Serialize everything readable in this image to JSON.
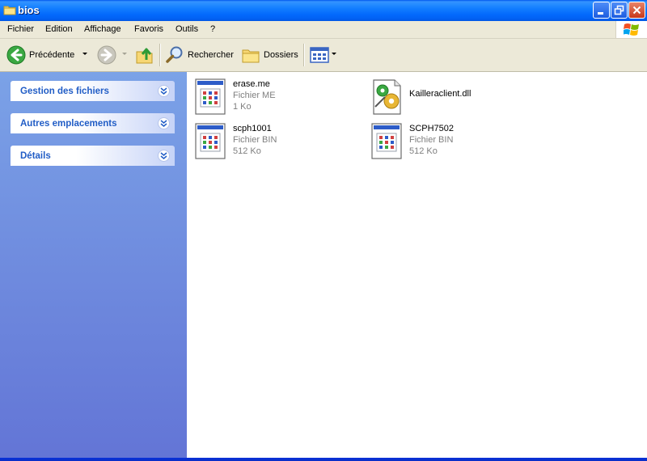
{
  "window": {
    "title": "bios",
    "icon": "folder-icon"
  },
  "menubar": {
    "items": [
      "Fichier",
      "Edition",
      "Affichage",
      "Favoris",
      "Outils",
      "?"
    ]
  },
  "toolbar": {
    "back_label": "Précédente",
    "search_label": "Rechercher",
    "folders_label": "Dossiers"
  },
  "taskpane": {
    "sections": [
      {
        "title": "Gestion des fichiers"
      },
      {
        "title": "Autres emplacements"
      },
      {
        "title": "Détails"
      }
    ]
  },
  "files": [
    {
      "name": "erase.me",
      "type": "Fichier ME",
      "size": "1 Ko",
      "icon": "generic-file-icon"
    },
    {
      "name": "Kailleraclient.dll",
      "type": "",
      "size": "",
      "icon": "dll-file-icon"
    },
    {
      "name": "scph1001",
      "type": "Fichier BIN",
      "size": "512 Ko",
      "icon": "generic-file-icon"
    },
    {
      "name": "SCPH7502",
      "type": "Fichier BIN",
      "size": "512 Ko",
      "icon": "generic-file-icon"
    }
  ],
  "colors": {
    "titlebar": "#0a5fe6",
    "taskpane_top": "#7ba2e7",
    "taskpane_bottom": "#6375d6",
    "pane_title": "#215dc6"
  }
}
